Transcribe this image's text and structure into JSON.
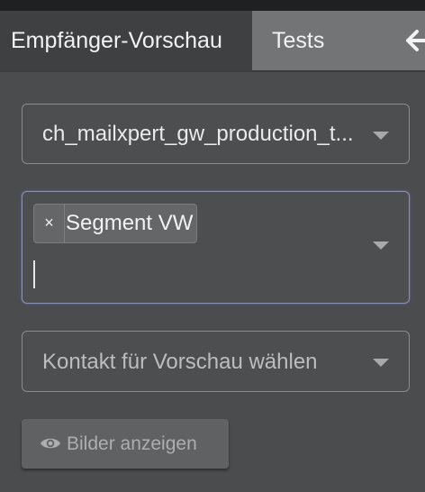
{
  "tabs": {
    "active_label": "Empfänger-Vorschau",
    "inactive_label": "Tests",
    "back_icon": "arrow-left-icon"
  },
  "list_select": {
    "value": "ch_mailxpert_gw_production_t..."
  },
  "segment_select": {
    "tags": [
      {
        "remove_glyph": "×",
        "label": "Segment VW"
      }
    ]
  },
  "contact_select": {
    "placeholder": "Kontakt für Vorschau wählen"
  },
  "show_images_button": {
    "icon": "eye-icon",
    "label": "Bilder anzeigen"
  },
  "colors": {
    "panel_bg": "#4b4c4e",
    "active_tab_bg": "#3f4042",
    "inactive_tab_bg": "#737476",
    "focus_border": "#8c8fb0"
  }
}
